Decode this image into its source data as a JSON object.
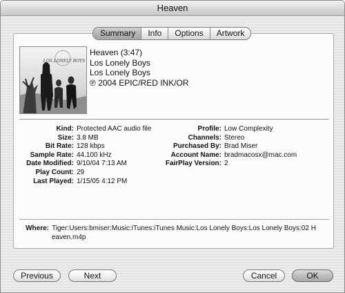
{
  "window": {
    "title": "Heaven"
  },
  "tabs": [
    {
      "label": "Summary",
      "active": true
    },
    {
      "label": "Info"
    },
    {
      "label": "Options"
    },
    {
      "label": "Artwork"
    }
  ],
  "track": {
    "title_line": "Heaven (3:47)",
    "artist": "Los Lonely Boys",
    "album": "Los Lonely Boys",
    "copyright": "℗ 2004 EPIC/RED INK/OR",
    "artwork_logo_text": "LOS LONELY BOYS"
  },
  "details_left": [
    {
      "label": "Kind:",
      "value": "Protected AAC audio file"
    },
    {
      "label": "Size:",
      "value": "3.8 MB"
    },
    {
      "label": "Bit Rate:",
      "value": "128 kbps"
    },
    {
      "label": "Sample Rate:",
      "value": "44.100 kHz"
    },
    {
      "label": "Date Modified:",
      "value": "9/10/04 7:13 AM"
    },
    {
      "label": "Play Count:",
      "value": "29"
    },
    {
      "label": "Last Played:",
      "value": "1/15/05 4:12 PM"
    }
  ],
  "details_right": [
    {
      "label": "Profile:",
      "value": "Low Complexity"
    },
    {
      "label": "Channels:",
      "value": "Stereo"
    },
    {
      "label": "Purchased By:",
      "value": "Brad Miser"
    },
    {
      "label": "Account Name:",
      "value": "bradmacosx@mac.com"
    },
    {
      "label": "FairPlay Version:",
      "value": "2"
    }
  ],
  "where": {
    "label": "Where:",
    "value": "Tiger:Users:bmiser:Music:iTunes:iTunes Music:Los Lonely Boys:Los Lonely Boys:02 Heaven.m4p"
  },
  "buttons": {
    "previous": "Previous",
    "next": "Next",
    "cancel": "Cancel",
    "ok": "OK"
  }
}
